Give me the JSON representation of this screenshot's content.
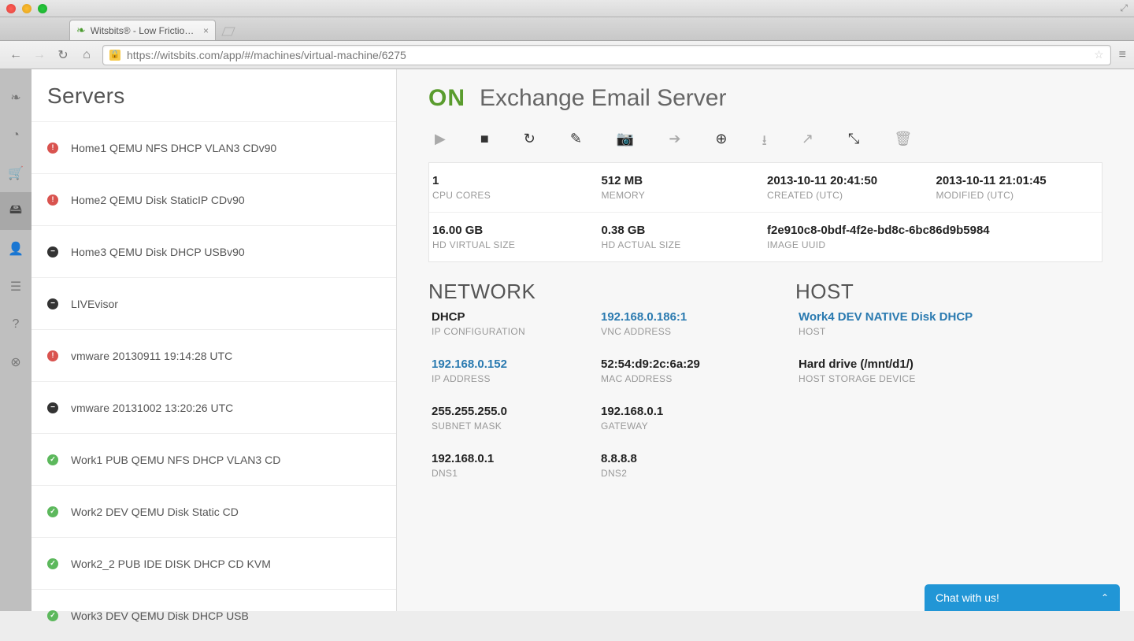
{
  "browser": {
    "tab_title": "Witsbits® - Low Friction V",
    "url": "https://witsbits.com/app/#/machines/virtual-machine/6275"
  },
  "sidebar": {
    "title": "Servers",
    "items": [
      {
        "status": "red",
        "label": "Home1 QEMU NFS DHCP VLAN3 CDv90"
      },
      {
        "status": "red",
        "label": "Home2 QEMU Disk StaticIP CDv90"
      },
      {
        "status": "black",
        "label": "Home3 QEMU Disk DHCP USBv90"
      },
      {
        "status": "black",
        "label": "LIVEvisor"
      },
      {
        "status": "red",
        "label": "vmware 20130911 19:14:28 UTC"
      },
      {
        "status": "black",
        "label": "vmware 20131002 13:20:26 UTC"
      },
      {
        "status": "green",
        "label": "Work1 PUB QEMU NFS DHCP VLAN3 CD"
      },
      {
        "status": "green",
        "label": "Work2 DEV QEMU Disk Static CD"
      },
      {
        "status": "green",
        "label": "Work2_2 PUB IDE DISK DHCP CD KVM"
      },
      {
        "status": "green",
        "label": "Work3 DEV QEMU Disk DHCP USB"
      }
    ]
  },
  "vm": {
    "status": "ON",
    "name": "Exchange Email Server",
    "stats": {
      "cpu_cores": {
        "value": "1",
        "label": "CPU CORES"
      },
      "memory": {
        "value": "512 MB",
        "label": "MEMORY"
      },
      "created": {
        "value": "2013-10-11 20:41:50",
        "label": "CREATED (UTC)"
      },
      "modified": {
        "value": "2013-10-11 21:01:45",
        "label": "MODIFIED (UTC)"
      },
      "hd_virtual": {
        "value": "16.00 GB",
        "label": "HD VIRTUAL SIZE"
      },
      "hd_actual": {
        "value": "0.38 GB",
        "label": "HD ACTUAL SIZE"
      },
      "image_uuid": {
        "value": "f2e910c8-0bdf-4f2e-bd8c-6bc86d9b5984",
        "label": "IMAGE UUID"
      }
    },
    "network": {
      "title": "NETWORK",
      "ip_config": {
        "value": "DHCP",
        "label": "IP CONFIGURATION"
      },
      "vnc": {
        "value": "192.168.0.186:1",
        "label": "VNC ADDRESS"
      },
      "ip": {
        "value": "192.168.0.152",
        "label": "IP ADDRESS"
      },
      "mac": {
        "value": "52:54:d9:2c:6a:29",
        "label": "MAC ADDRESS"
      },
      "subnet": {
        "value": "255.255.255.0",
        "label": "SUBNET MASK"
      },
      "gateway": {
        "value": "192.168.0.1",
        "label": "GATEWAY"
      },
      "dns1": {
        "value": "192.168.0.1",
        "label": "DNS1"
      },
      "dns2": {
        "value": "8.8.8.8",
        "label": "DNS2"
      }
    },
    "host": {
      "title": "HOST",
      "host": {
        "value": "Work4 DEV NATIVE Disk DHCP",
        "label": "HOST"
      },
      "storage": {
        "value": "Hard drive (/mnt/d1/)",
        "label": "HOST STORAGE DEVICE"
      }
    }
  },
  "chat": {
    "label": "Chat with us!"
  }
}
